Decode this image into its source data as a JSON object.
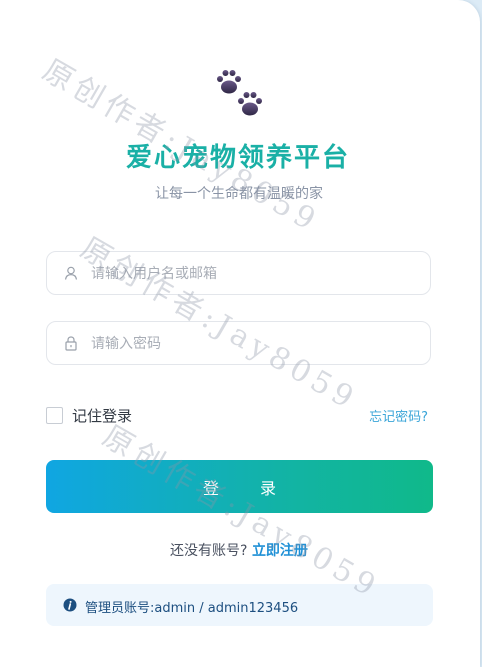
{
  "app": {
    "title": "爱心宠物领养平台",
    "subtitle": "让每一个生命都有温暖的家",
    "logo_icon": "paw-print-icon"
  },
  "form": {
    "username": {
      "placeholder": "请输入用户名或邮箱",
      "value": "",
      "icon": "user-icon"
    },
    "password": {
      "placeholder": "请输入密码",
      "value": "",
      "icon": "lock-icon"
    },
    "remember_label": "记住登录",
    "remember_checked": false,
    "forgot_label": "忘记密码?",
    "login_label": "登 录"
  },
  "register": {
    "prompt": "还没有账号?",
    "link_label": "立即注册"
  },
  "admin_hint": {
    "icon": "info-icon",
    "text": "管理员账号:admin / admin123456"
  },
  "watermark": {
    "text": "原创作者:Jay8059"
  },
  "colors": {
    "title": "#1ab0a6",
    "button_gradient_start": "#10a6e2",
    "button_gradient_end": "#10b98a",
    "link": "#1e90d6",
    "hint_background": "#eef6fd"
  }
}
